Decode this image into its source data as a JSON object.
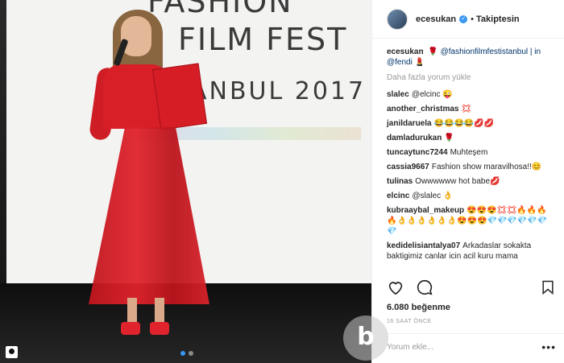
{
  "photo": {
    "screen_line1": "FASHION",
    "screen_line2": "FILM FEST",
    "screen_line3": "ANBUL 2017"
  },
  "post": {
    "username": "ecesukan",
    "follow_label": "Takiptesin",
    "caption_user": "ecesukan",
    "caption_text": "🌹 @fashionfilmfestistanbul | in @fendi 💄",
    "load_more": "Daha fazla yorum yükle",
    "likes": "6.080 beğenme",
    "time": "16 SAAT ÖNCE",
    "add_comment_placeholder": "Yorum ekle...",
    "more_icon": "•••"
  },
  "comments": [
    {
      "user": "slalec",
      "text": "@elcinc 😜"
    },
    {
      "user": "another_christmas",
      "text": "💢"
    },
    {
      "user": "janildaruela",
      "text": "😂😂😂😂💋💋"
    },
    {
      "user": "damladurukan",
      "text": "🌹"
    },
    {
      "user": "tuncaytunc7244",
      "text": "Muhteşem"
    },
    {
      "user": "cassia9667",
      "text": "Fashion show maravilhosa!!😊"
    },
    {
      "user": "tulinas",
      "text": "Owwwwww hot babe💋"
    },
    {
      "user": "elcinc",
      "text": "@slalec 👌"
    },
    {
      "user": "kubraaybal_makeup",
      "text": "😍😍😍💢💢🔥🔥🔥🔥👌👌👌👌👌👌😍😍😍💎💎💎💎💎💎💎"
    },
    {
      "user": "kedidelisiantalya07",
      "text": "Arkadaslar sokakta baktigimiz canlar icin acil kuru mama"
    }
  ],
  "watermark_letter": "b",
  "colors": {
    "accent": "#3897f0",
    "dress_red": "#d81f28",
    "link": "#003569"
  }
}
